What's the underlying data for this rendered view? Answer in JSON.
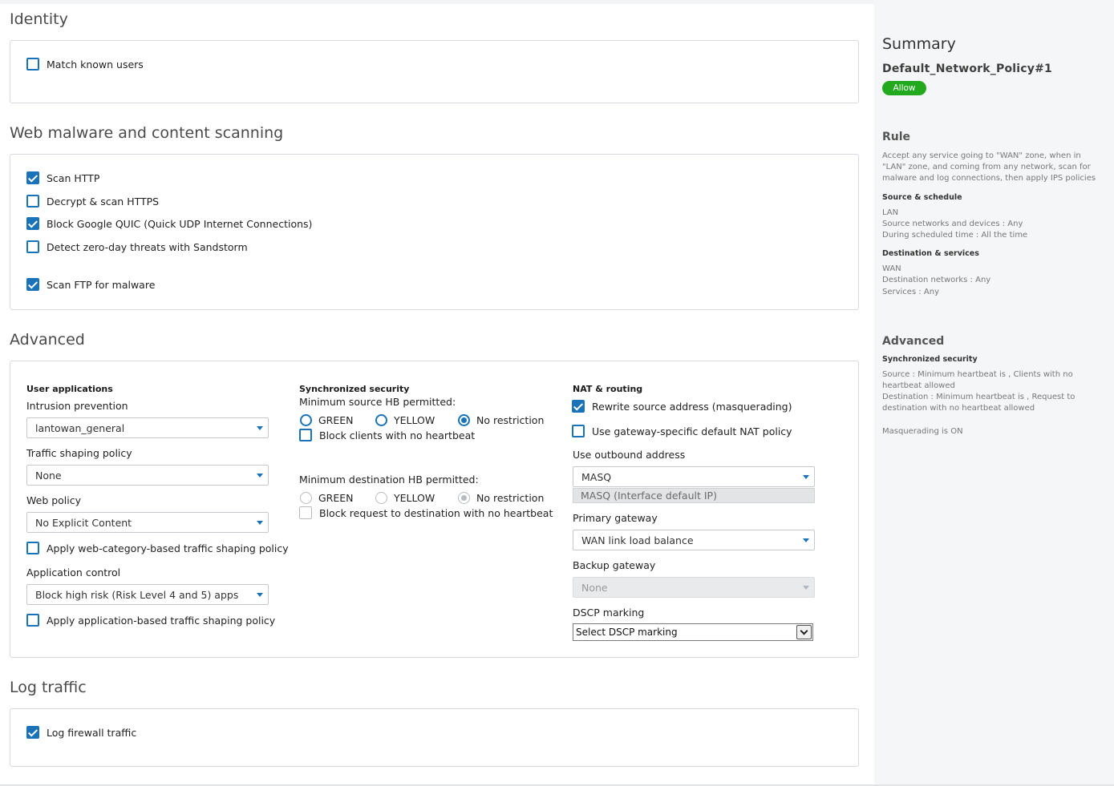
{
  "sections": {
    "identity": "Identity",
    "web": "Web malware and content scanning",
    "advanced": "Advanced",
    "log": "Log traffic"
  },
  "identity": {
    "match_known_users": "Match known users"
  },
  "web": {
    "scan_http": "Scan HTTP",
    "decrypt_https": "Decrypt & scan HTTPS",
    "block_quic": "Block Google QUIC (Quick UDP Internet Connections)",
    "zero_day": "Detect zero-day threats with Sandstorm",
    "scan_ftp": "Scan FTP for malware"
  },
  "advanced": {
    "user_apps": {
      "heading": "User applications",
      "ips_label": "Intrusion prevention",
      "ips_value": "lantowan_general",
      "shaping_label": "Traffic shaping policy",
      "shaping_value": "None",
      "web_policy_label": "Web policy",
      "web_policy_value": "No Explicit Content",
      "apply_web_cat": "Apply web-category-based traffic shaping policy",
      "app_control_label": "Application control",
      "app_control_value": "Block high risk (Risk Level 4 and 5) apps",
      "apply_app_shaping": "Apply application-based traffic shaping policy"
    },
    "sync": {
      "heading": "Synchronized security",
      "min_src": "Minimum source HB permitted:",
      "green": "GREEN",
      "yellow": "YELLOW",
      "no_restriction": "No restriction",
      "block_clients": "Block clients with no heartbeat",
      "min_dst": "Minimum destination HB permitted:",
      "block_request": "Block request to destination with no heartbeat"
    },
    "nat": {
      "heading": "NAT & routing",
      "rewrite_source": "Rewrite source address (masquerading)",
      "gateway_nat": "Use gateway-specific default NAT policy",
      "outbound_label": "Use outbound address",
      "outbound_value": "MASQ",
      "outbound_hint": "MASQ (Interface default IP)",
      "primary_gw_label": "Primary gateway",
      "primary_gw_value": "WAN link load balance",
      "backup_gw_label": "Backup gateway",
      "backup_gw_value": "None",
      "dscp_label": "DSCP marking",
      "dscp_value": "Select DSCP marking"
    }
  },
  "log": {
    "log_firewall": "Log firewall traffic"
  },
  "summary": {
    "title": "Summary",
    "policy_name": "Default_Network_Policy#1",
    "action": "Allow",
    "rule_heading": "Rule",
    "rule_text": "Accept any service going to \"WAN\" zone, when in \"LAN\" zone, and coming from any network, scan for malware and log connections, then apply IPS policies",
    "source_heading": "Source & schedule",
    "source_zone": "LAN",
    "source_networks": "Source networks and devices : Any",
    "schedule": "During scheduled time : All the time",
    "dest_heading": "Destination & services",
    "dest_zone": "WAN",
    "dest_networks": "Destination networks : Any",
    "services": "Services : Any",
    "advanced_heading": "Advanced",
    "sync_heading": "Synchronized security",
    "sync_source": "Source : Minimum heartbeat is , Clients with no heartbeat allowed",
    "sync_dest": "Destination : Minimum heartbeat is , Request to destination with no heartbeat allowed",
    "masquerading": "Masquerading is ON"
  },
  "colors": {
    "accent": "#1a73b8",
    "allow_badge": "#22a91d"
  }
}
